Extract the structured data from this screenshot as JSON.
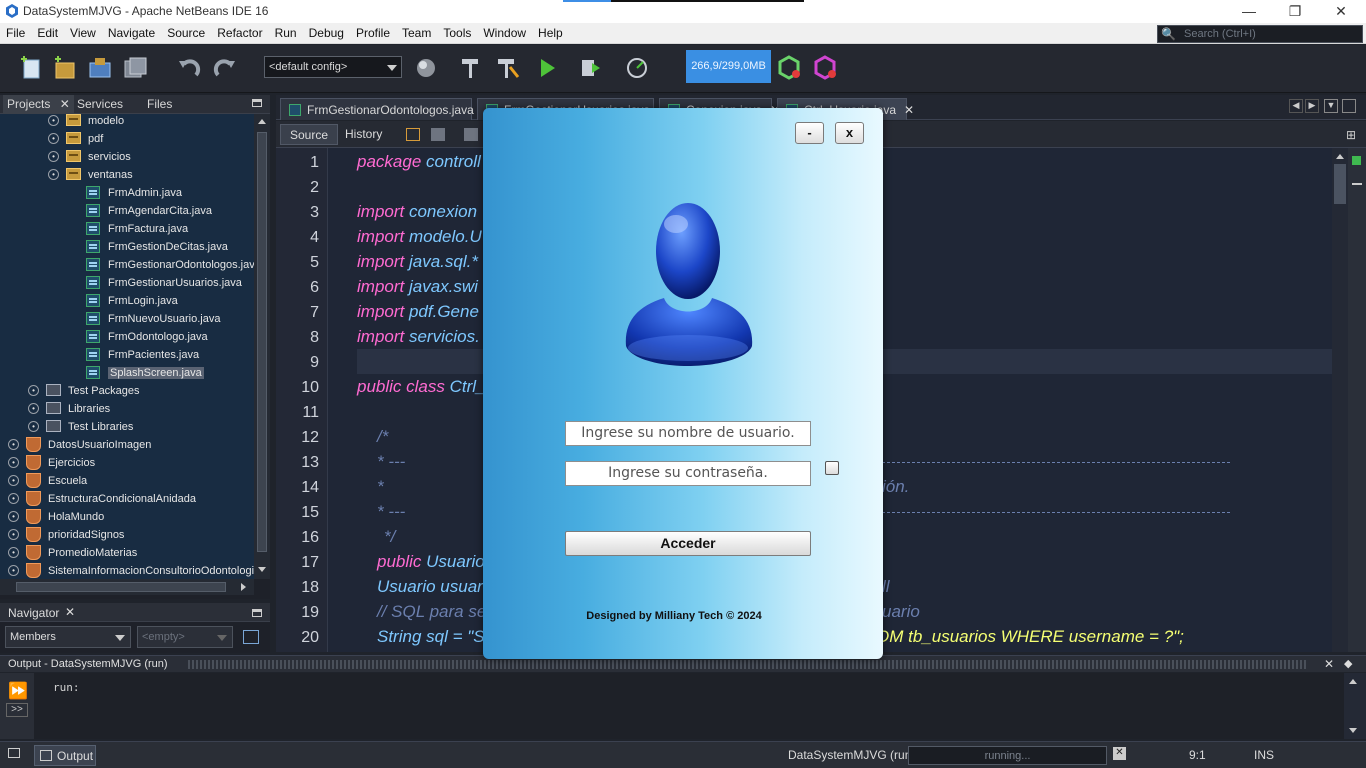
{
  "window": {
    "title": "DataSystemMJVG - Apache NetBeans IDE 16",
    "minimize": "—",
    "maximize": "❐",
    "close": "✕"
  },
  "menu": {
    "items": [
      "File",
      "Edit",
      "View",
      "Navigate",
      "Source",
      "Refactor",
      "Run",
      "Debug",
      "Profile",
      "Team",
      "Tools",
      "Window",
      "Help"
    ],
    "search_placeholder": "Search (Ctrl+I)"
  },
  "toolbar": {
    "config": "<default config>",
    "memory": "266,9/299,0MB"
  },
  "projects_panel": {
    "tabs": [
      "Projects",
      "Services",
      "Files"
    ],
    "tree": [
      {
        "label": "modelo",
        "kind": "folder",
        "depth": 2
      },
      {
        "label": "pdf",
        "kind": "folder",
        "depth": 2
      },
      {
        "label": "servicios",
        "kind": "folder",
        "depth": 2
      },
      {
        "label": "ventanas",
        "kind": "folder",
        "depth": 2
      },
      {
        "label": "FrmAdmin.java",
        "kind": "java",
        "depth": 3
      },
      {
        "label": "FrmAgendarCita.java",
        "kind": "java",
        "depth": 3
      },
      {
        "label": "FrmFactura.java",
        "kind": "java",
        "depth": 3
      },
      {
        "label": "FrmGestionDeCitas.java",
        "kind": "java",
        "depth": 3
      },
      {
        "label": "FrmGestionarOdontologos.jav",
        "kind": "java",
        "depth": 3
      },
      {
        "label": "FrmGestionarUsuarios.java",
        "kind": "java",
        "depth": 3
      },
      {
        "label": "FrmLogin.java",
        "kind": "java",
        "depth": 3
      },
      {
        "label": "FrmNuevoUsuario.java",
        "kind": "java",
        "depth": 3
      },
      {
        "label": "FrmOdontologo.java",
        "kind": "java",
        "depth": 3
      },
      {
        "label": "FrmPacientes.java",
        "kind": "java",
        "depth": 3
      },
      {
        "label": "SplashScreen.java",
        "kind": "java",
        "depth": 3,
        "selected": true
      },
      {
        "label": "Test Packages",
        "kind": "pkg",
        "depth": 1
      },
      {
        "label": "Libraries",
        "kind": "pkg",
        "depth": 1
      },
      {
        "label": "Test Libraries",
        "kind": "pkg",
        "depth": 1
      },
      {
        "label": "DatosUsuarioImagen",
        "kind": "project",
        "depth": 0
      },
      {
        "label": "Ejercicios",
        "kind": "project",
        "depth": 0
      },
      {
        "label": "Escuela",
        "kind": "project",
        "depth": 0
      },
      {
        "label": "EstructuraCondicionalAnidada",
        "kind": "project",
        "depth": 0
      },
      {
        "label": "HolaMundo",
        "kind": "project",
        "depth": 0
      },
      {
        "label": "prioridadSignos",
        "kind": "project",
        "depth": 0
      },
      {
        "label": "PromedioMaterias",
        "kind": "project",
        "depth": 0
      },
      {
        "label": "SistemaInformacionConsultorioOdontologic",
        "kind": "project",
        "depth": 0
      }
    ]
  },
  "navigator": {
    "title": "Navigator",
    "members": "Members",
    "filter": "<empty>"
  },
  "editor": {
    "tabs": [
      "FrmGestionarOdontologos.java",
      "FrmGestionarUsuarios.java",
      "Conexion.java",
      "Ctrl_Usuario.java"
    ],
    "source_tab": "Source",
    "history_tab": "History",
    "line_numbers": [
      "1",
      "2",
      "3",
      "4",
      "5",
      "6",
      "7",
      "8",
      "9",
      "10",
      "11",
      "12",
      "13",
      "14",
      "15",
      "16",
      "17",
      "18",
      "19",
      "20"
    ],
    "lines": {
      "l1_kw": "package",
      "l1_tx": "controll",
      "l3_kw": "import",
      "l3_tx": "conexion",
      "l4_kw": "import",
      "l4_tx": "modelo.U",
      "l5_kw": "import",
      "l5_tx": "java.sql.*",
      "l6_kw": "import",
      "l6_tx": "javax.swi",
      "l7_kw": "import",
      "l7_tx": "pdf.Gene",
      "l8_kw": "import",
      "l8_tx": "servicios.",
      "l10_kw": "public class",
      "l10_tx": "Ctrl_",
      "l12": "/*",
      "l13": "* ---",
      "l14": "*",
      "l14_right": "ión.",
      "l15": "* ---",
      "l16": "*/",
      "l17_kw": "public",
      "l17_tx": "Usuario",
      "l18_tx": "Usuario usuar",
      "l18_right": "ll",
      "l19_cm": "// SQL para se",
      "l19_right": "uario",
      "l20_tx": "String sql = \"S",
      "l20_right": "OM tb_usuarios WHERE username = ?\";"
    }
  },
  "output": {
    "title": "Output - DataSystemMJVG (run)",
    "text": "run:",
    "tab": "Output"
  },
  "statusbar": {
    "project": "DataSystemMJVG (run)",
    "progress": "running...",
    "position": "9:1",
    "mode": "INS"
  },
  "splash": {
    "minimize_label": "-",
    "close_label": "x",
    "username_placeholder": "Ingrese su nombre de usuario.",
    "password_placeholder": "Ingrese su contraseña.",
    "button_label": "Acceder",
    "credit": "Designed by Milliany Tech © 2024"
  }
}
